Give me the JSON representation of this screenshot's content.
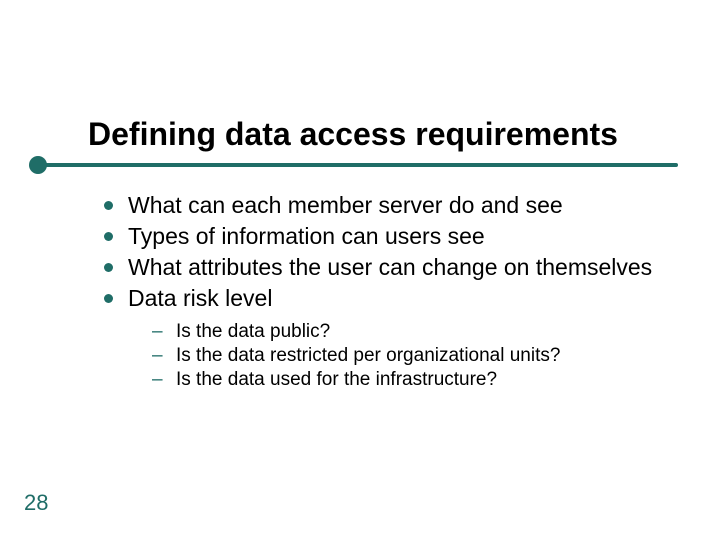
{
  "slide": {
    "title": "Defining data access requirements",
    "bullets": [
      "What can each member server do and see",
      "Types of information can users see",
      "What attributes the user can change on  themselves",
      "Data risk level"
    ],
    "subbullets": [
      "Is the data public?",
      "Is the data restricted per organizational units?",
      "Is the data used for the infrastructure?"
    ],
    "page_number": "28"
  },
  "colors": {
    "accent": "#1f6d67"
  }
}
